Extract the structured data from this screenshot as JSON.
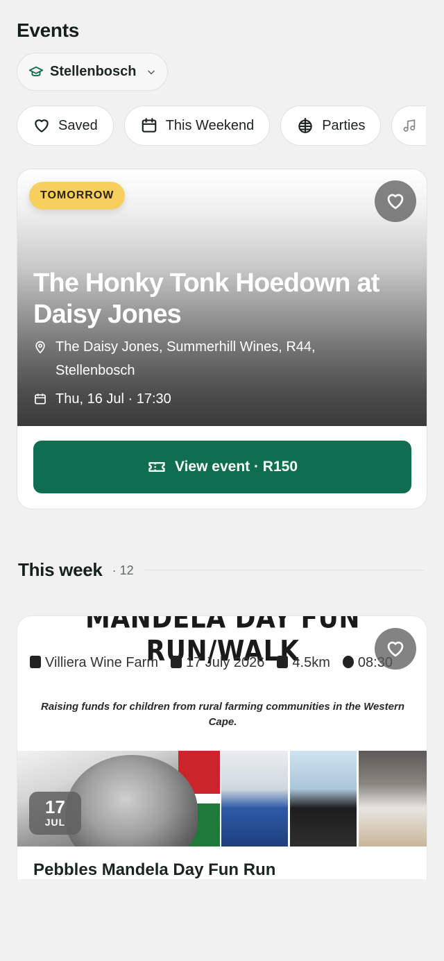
{
  "header": {
    "title": "Events"
  },
  "campus": {
    "label": "Stellenbosch"
  },
  "filters": [
    {
      "label": "Saved",
      "icon": "heart-icon"
    },
    {
      "label": "This Weekend",
      "icon": "calendar-icon"
    },
    {
      "label": "Parties",
      "icon": "disco-ball-icon"
    },
    {
      "label": "",
      "icon": "music-note-icon"
    }
  ],
  "featured": {
    "badge": "TOMORROW",
    "title": "The Honky Tonk Hoedown at Daisy Jones",
    "location": "The Daisy Jones, Summerhill Wines, R44, Stellenbosch",
    "datetime": "Thu, 16 Jul · 17:30",
    "cta": "View event · R150"
  },
  "this_week": {
    "title": "This week",
    "count": "· 12"
  },
  "card": {
    "poster_heading": "MANDELA DAY FUN RUN/WALK",
    "poster_venue": "Villiera Wine Farm",
    "poster_date": "17 July 2026",
    "poster_distance": "4.5km",
    "poster_time": "08:30",
    "poster_tagline": "Raising funds for children from rural farming communities in the Western Cape.",
    "date_day": "17",
    "date_month": "JUL",
    "name": "Pebbles Mandela Day Fun Run"
  },
  "colors": {
    "accent_green": "#0e6e4f",
    "badge_yellow": "#f7cf5e",
    "background": "#f0f1f0"
  }
}
